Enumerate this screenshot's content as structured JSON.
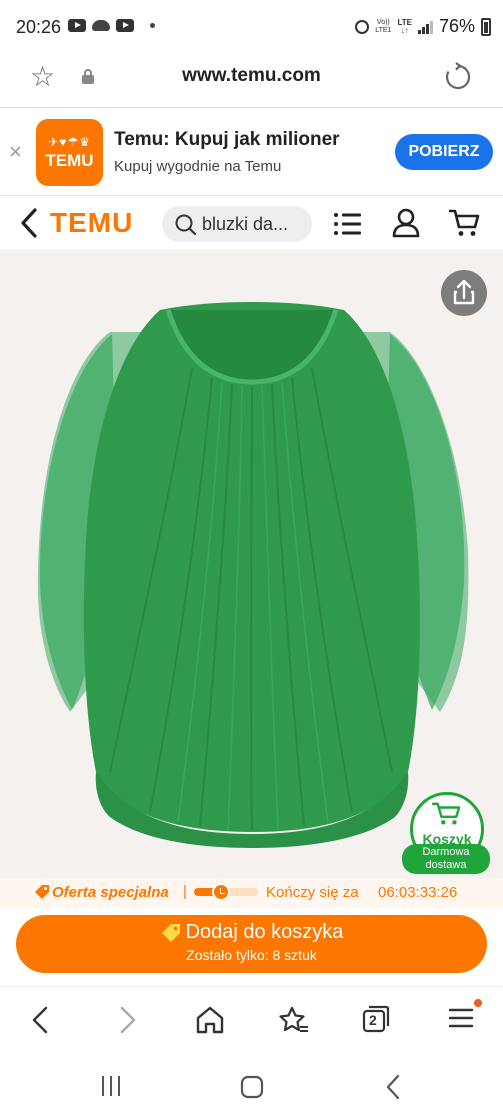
{
  "status_bar": {
    "time": "20:26",
    "network_top": "Vo))",
    "network_bottom": "LTE1",
    "lte": "LTE",
    "lte_arrows": "↓↑",
    "battery": "76%"
  },
  "browser": {
    "url": "www.temu.com"
  },
  "app_banner": {
    "close": "×",
    "icon_glyphs": "✈♥☂♛",
    "icon_word": "TEMU",
    "title": "Temu: Kupuj jak milioner",
    "subtitle": "Kupuj wygodnie na Temu",
    "button": "POBIERZ"
  },
  "header": {
    "logo": "TEMU",
    "search_text": "bluzki da..."
  },
  "product": {
    "cart_badge_label": "Koszyk",
    "free_delivery_line1": "Darmowa",
    "free_delivery_line2": "dostawa"
  },
  "offer": {
    "special_offer": "Oferta specjalna",
    "separator": "|",
    "progress": 0.35,
    "ends_label": "Kończy się za",
    "countdown": "06:03:33:26"
  },
  "add_to_cart": {
    "label": "Dodaj do koszyka",
    "stock": "Zostało tylko: 8 sztuk"
  },
  "toolbar": {
    "tabs_count": "2"
  },
  "colors": {
    "brand_orange": "#fb7701",
    "cart_green": "#1fa53a",
    "banner_button_blue": "#1a73e8",
    "blouse_green": "#2f9a4c"
  }
}
